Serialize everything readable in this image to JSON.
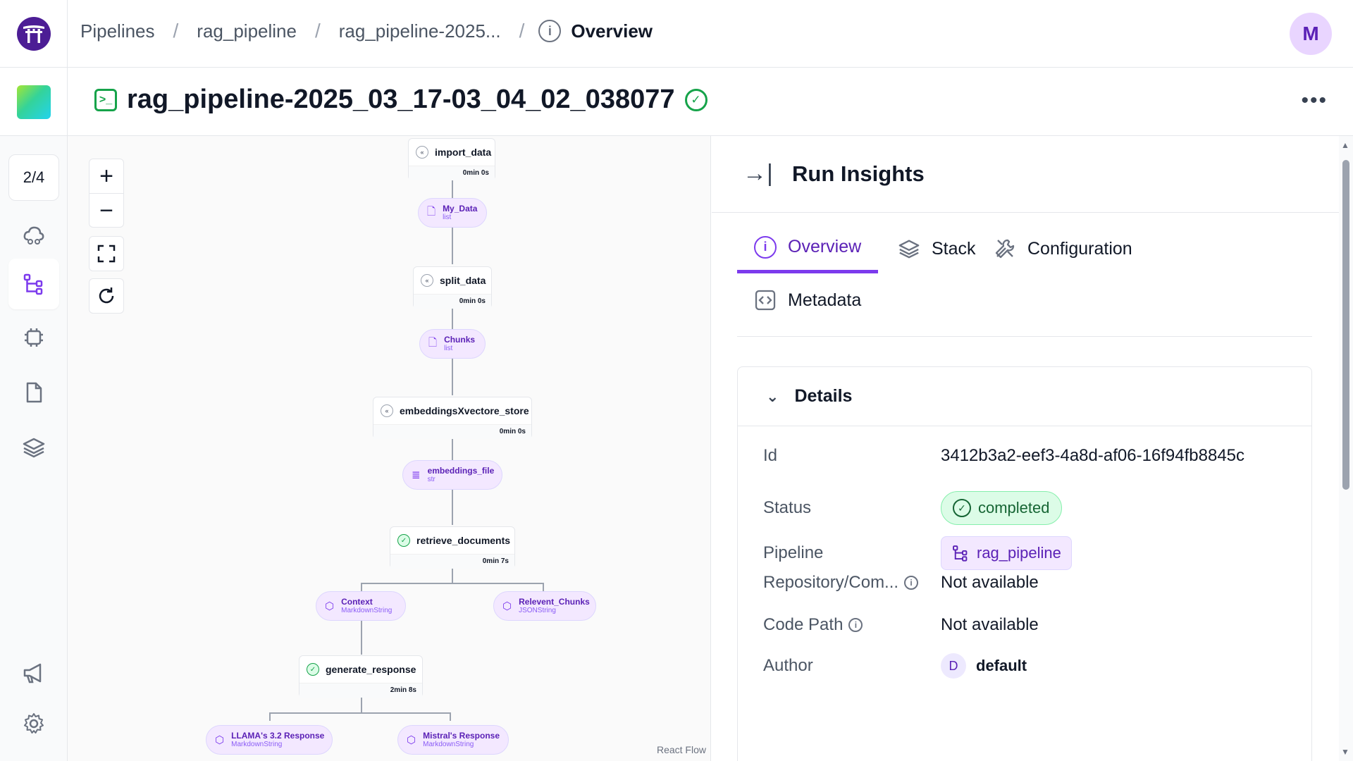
{
  "breadcrumbs": [
    "Pipelines",
    "rag_pipeline",
    "rag_pipeline-2025..."
  ],
  "breadcrumb_current": "Overview",
  "user_avatar": "M",
  "run_title": "rag_pipeline-2025_03_17-03_04_02_038077",
  "sidebar": {
    "badge": "2/4"
  },
  "dag": {
    "steps": [
      {
        "name": "import_data",
        "duration": "0min 0s",
        "status": "cached"
      },
      {
        "name": "split_data",
        "duration": "0min 0s",
        "status": "cached"
      },
      {
        "name": "embeddingsXvectore_store",
        "duration": "0min 0s",
        "status": "cached"
      },
      {
        "name": "retrieve_documents",
        "duration": "0min 7s",
        "status": "completed"
      },
      {
        "name": "generate_response",
        "duration": "2min 8s",
        "status": "completed"
      }
    ],
    "artifacts": [
      {
        "name": "My_Data",
        "type": "list"
      },
      {
        "name": "Chunks",
        "type": "list"
      },
      {
        "name": "embeddings_file",
        "type": "str"
      },
      {
        "name": "Context",
        "type": "MarkdownString"
      },
      {
        "name": "Relevent_Chunks",
        "type": "JSONString"
      },
      {
        "name": "LLAMA's 3.2 Response",
        "type": "MarkdownString"
      },
      {
        "name": "Mistral's Response",
        "type": "MarkdownString"
      }
    ],
    "attribution": "React Flow"
  },
  "panel": {
    "title": "Run Insights",
    "tabs": [
      "Overview",
      "Stack",
      "Configuration",
      "Metadata"
    ],
    "details": {
      "header": "Details",
      "rows": [
        {
          "label": "Id",
          "value": "3412b3a2-eef3-4a8d-af06-16f94fb8845c"
        },
        {
          "label": "Status",
          "value": "completed"
        },
        {
          "label": "Pipeline",
          "value": "rag_pipeline"
        },
        {
          "label": "Repository/Com...",
          "value": "Not available"
        },
        {
          "label": "Code Path",
          "value": "Not available"
        },
        {
          "label": "Author",
          "value": "default",
          "avatar": "D"
        }
      ]
    }
  },
  "colors": {
    "accent": "#7c3aed",
    "success": "#16a34a",
    "artifact_bg": "#f3e8ff"
  }
}
